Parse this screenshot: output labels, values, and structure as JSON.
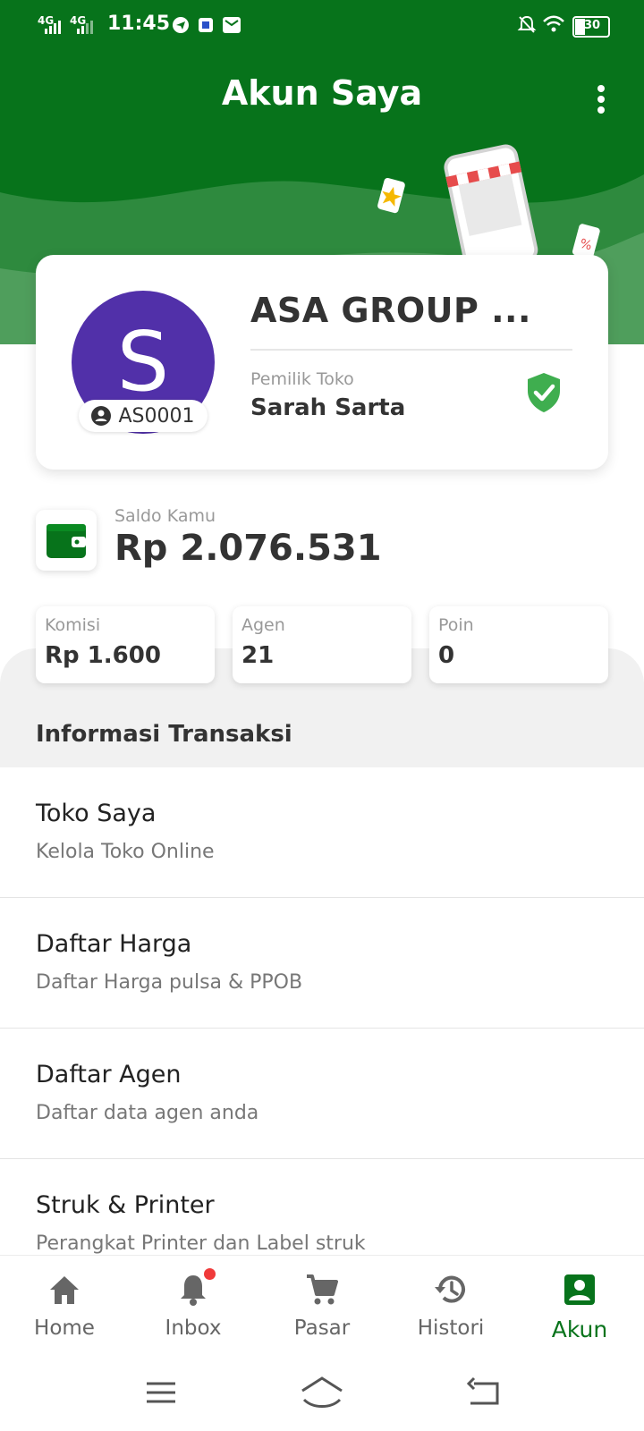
{
  "status_bar": {
    "network_1": "4G",
    "network_2": "4G",
    "time": "11:45",
    "battery": "30"
  },
  "header": {
    "title": "Akun Saya"
  },
  "profile": {
    "avatar_initial": "S",
    "account_id": "AS0001",
    "store_name": "ASA GROUP ...",
    "owner_label": "Pemilik Toko",
    "owner_name": "Sarah Sarta"
  },
  "balance": {
    "label": "Saldo Kamu",
    "value": "Rp 2.076.531"
  },
  "stats": [
    {
      "label": "Komisi",
      "value": "Rp 1.600"
    },
    {
      "label": "Agen",
      "value": "21"
    },
    {
      "label": "Poin",
      "value": "0"
    }
  ],
  "section": {
    "title": "Informasi Transaksi"
  },
  "menu": [
    {
      "title": "Toko Saya",
      "subtitle": "Kelola Toko Online"
    },
    {
      "title": "Daftar Harga",
      "subtitle": "Daftar Harga pulsa & PPOB"
    },
    {
      "title": "Daftar Agen",
      "subtitle": "Daftar data agen anda"
    },
    {
      "title": "Struk & Printer",
      "subtitle": "Perangkat Printer dan Label struk"
    }
  ],
  "bottom_nav": [
    {
      "label": "Home",
      "icon": "home-icon"
    },
    {
      "label": "Inbox",
      "icon": "bell-icon"
    },
    {
      "label": "Pasar",
      "icon": "cart-icon"
    },
    {
      "label": "Histori",
      "icon": "history-icon"
    },
    {
      "label": "Akun",
      "icon": "account-icon",
      "active": true
    }
  ],
  "colors": {
    "brand_green": "#07731b",
    "avatar_purple": "#5130a9",
    "verified_green": "#3fae4f",
    "notification_red": "#f03a3a"
  }
}
